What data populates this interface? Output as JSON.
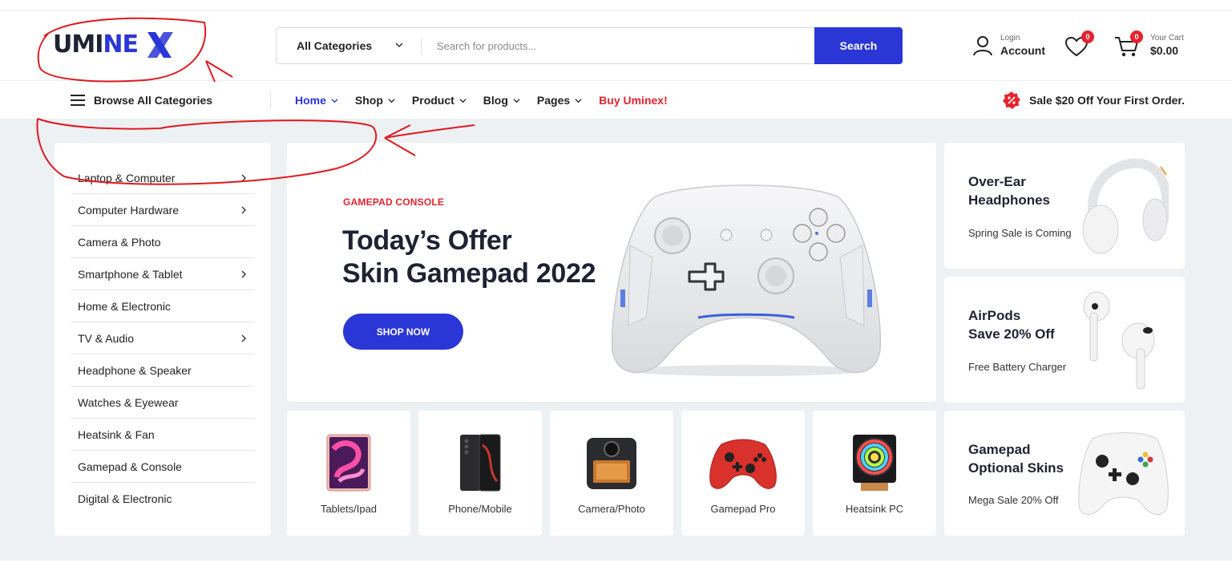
{
  "header": {
    "logo_text_a": "UMI",
    "logo_text_b": "NE",
    "search": {
      "category": "All Categories",
      "placeholder": "Search for products...",
      "button": "Search"
    },
    "account": {
      "small": "Login",
      "big": "Account"
    },
    "wishlist": {
      "count": "0"
    },
    "cart": {
      "count": "0",
      "small": "Your Cart",
      "big": "$0.00"
    }
  },
  "nav": {
    "browse": "Browse All Categories",
    "items": [
      {
        "label": "Home",
        "dropdown": true,
        "active": true
      },
      {
        "label": "Shop",
        "dropdown": true
      },
      {
        "label": "Product",
        "dropdown": true
      },
      {
        "label": "Blog",
        "dropdown": true
      },
      {
        "label": "Pages",
        "dropdown": true
      },
      {
        "label": "Buy Uminex!",
        "dropdown": false,
        "accent": true
      }
    ],
    "promo": "Sale $20 Off Your First Order."
  },
  "categories": [
    {
      "label": "Laptop & Computer",
      "has_sub": true
    },
    {
      "label": "Computer Hardware",
      "has_sub": true
    },
    {
      "label": "Camera & Photo",
      "has_sub": false
    },
    {
      "label": "Smartphone & Tablet",
      "has_sub": true
    },
    {
      "label": "Home & Electronic",
      "has_sub": false
    },
    {
      "label": "TV & Audio",
      "has_sub": true
    },
    {
      "label": "Headphone & Speaker",
      "has_sub": false
    },
    {
      "label": "Watches & Eyewear",
      "has_sub": false
    },
    {
      "label": "Heatsink & Fan",
      "has_sub": false
    },
    {
      "label": "Gamepad & Console",
      "has_sub": false
    },
    {
      "label": "Digital & Electronic",
      "has_sub": false
    }
  ],
  "hero": {
    "tag": "GAMEPAD CONSOLE",
    "title_line1": "Today’s Offer",
    "title_line2": "Skin Gamepad 2022",
    "button": "SHOP NOW"
  },
  "side_cards": [
    {
      "title1": "Over-Ear",
      "title2": "Headphones",
      "subtitle": "Spring Sale is Coming"
    },
    {
      "title1": "AirPods",
      "title2": "Save 20% Off",
      "subtitle": "Free Battery Charger"
    },
    {
      "title1": "Gamepad",
      "title2": "Optional Skins",
      "subtitle": "Mega Sale 20% Off"
    }
  ],
  "products": [
    {
      "label": "Tablets/Ipad"
    },
    {
      "label": "Phone/Mobile"
    },
    {
      "label": "Camera/Photo"
    },
    {
      "label": "Gamepad Pro"
    },
    {
      "label": "Heatsink PC"
    }
  ],
  "colors": {
    "brand": "#2a36d6",
    "accent_red": "#e6232f",
    "background": "#eef1f3",
    "annotation": "#e0191f"
  }
}
